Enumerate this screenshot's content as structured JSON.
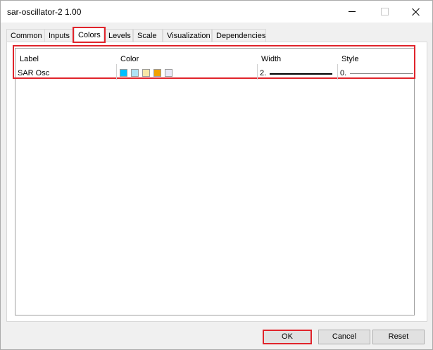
{
  "window": {
    "title": "sar-oscillator-2 1.00"
  },
  "tabs": [
    {
      "label": "Common"
    },
    {
      "label": "Inputs"
    },
    {
      "label": "Colors"
    },
    {
      "label": "Levels"
    },
    {
      "label": "Scale"
    },
    {
      "label": "Visualization"
    },
    {
      "label": "Dependencies"
    }
  ],
  "active_tab": "Colors",
  "table": {
    "columns": {
      "label": "Label",
      "color": "Color",
      "width": "Width",
      "style": "Style"
    },
    "rows": [
      {
        "label": "SAR Osc",
        "colors": [
          "#00bfff",
          "#aee3f5",
          "#f7e7a6",
          "#f0a000",
          "#e8e8f6"
        ],
        "width": "2.",
        "style": "0."
      }
    ]
  },
  "buttons": {
    "ok": "OK",
    "cancel": "Cancel",
    "reset": "Reset"
  }
}
